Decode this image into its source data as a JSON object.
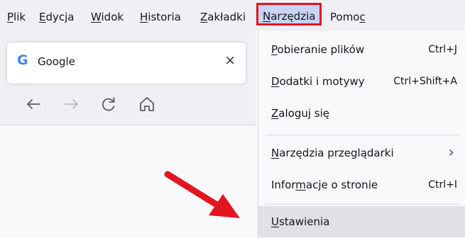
{
  "menubar": {
    "items": [
      {
        "pre": "",
        "key": "P",
        "post": "lik"
      },
      {
        "pre": "",
        "key": "E",
        "post": "dycja"
      },
      {
        "pre": "",
        "key": "W",
        "post": "idok"
      },
      {
        "pre": "",
        "key": "H",
        "post": "istoria"
      },
      {
        "pre": "",
        "key": "Z",
        "post": "akładki"
      },
      {
        "pre": "",
        "key": "N",
        "post": "arzędzia"
      },
      {
        "pre": "Pomo",
        "key": "c",
        "post": ""
      }
    ],
    "active_index": 5
  },
  "tab": {
    "favicon": "G",
    "title": "Google",
    "close_glyph": "×"
  },
  "nav": {
    "back_icon": "arrow-left-icon",
    "forward_icon": "arrow-right-icon",
    "reload_icon": "reload-icon",
    "home_icon": "home-icon"
  },
  "menu": {
    "items": [
      {
        "pre": "",
        "key": "P",
        "post": "obieranie plików",
        "shortcut": "Ctrl+J"
      },
      {
        "pre": "",
        "key": "D",
        "post": "odatki i motywy",
        "shortcut": "Ctrl+Shift+A"
      },
      {
        "pre": "",
        "key": "Z",
        "post": "aloguj się",
        "shortcut": ""
      },
      {
        "pre": "",
        "key": "N",
        "post": "arzędzia przeglądarki",
        "shortcut": "›"
      },
      {
        "pre": "Infor",
        "key": "m",
        "post": "acje o stronie",
        "shortcut": "Ctrl+I"
      },
      {
        "pre": "",
        "key": "U",
        "post": "stawienia",
        "shortcut": ""
      }
    ]
  },
  "colors": {
    "highlight_border": "#e4151f",
    "arrow": "#e4151f",
    "hover_bg": "#e0e0e6"
  }
}
